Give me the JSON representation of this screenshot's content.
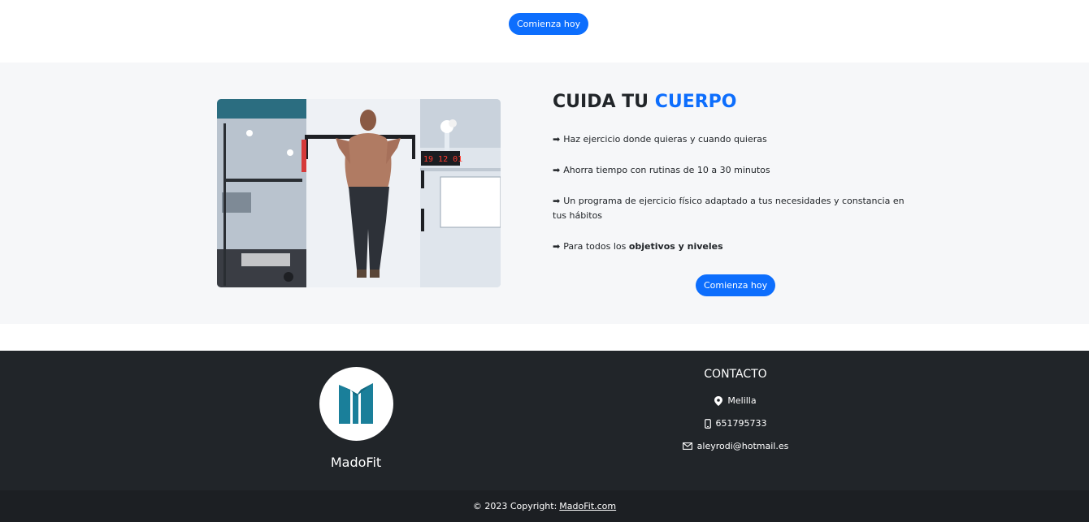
{
  "top_cta": {
    "label": "Comienza hoy"
  },
  "feature": {
    "title_prefix": "CUIDA TU",
    "title_accent": "CUERPO",
    "bullets": [
      {
        "arrow": "➡",
        "text": "Haz ejercicio donde quieras y cuando quieras",
        "bold": ""
      },
      {
        "arrow": "➡",
        "text": "Ahorra tiempo con rutinas de 10 a 30 minutos",
        "bold": ""
      },
      {
        "arrow": "➡",
        "text": "Un programa de ejercicio físico adaptado a tus necesidades y constancia en tus hábitos",
        "bold": ""
      },
      {
        "arrow": "➡",
        "text": "Para todos los ",
        "bold": "objetivos y niveles"
      }
    ],
    "cta_label": "Comienza hoy",
    "clock_display": "19 12 01"
  },
  "footer": {
    "brand_name": "MadoFit",
    "contact_title": "CONTACTO",
    "location": "Melilla",
    "phone": "651795733",
    "email": "aleyrodi@hotmail.es",
    "icons": {
      "location": "map-pin-icon",
      "phone": "phone-icon",
      "email": "envelope-icon"
    }
  },
  "copyright": {
    "prefix": "© 2023 Copyright:",
    "link_text": "MadoFit.com"
  },
  "colors": {
    "primary": "#0d6efd",
    "footer_bg": "#212529",
    "copyright_bg": "#1c1f23",
    "feature_bg": "#f6f7f9",
    "logo_teal": "#1a7f9a"
  }
}
